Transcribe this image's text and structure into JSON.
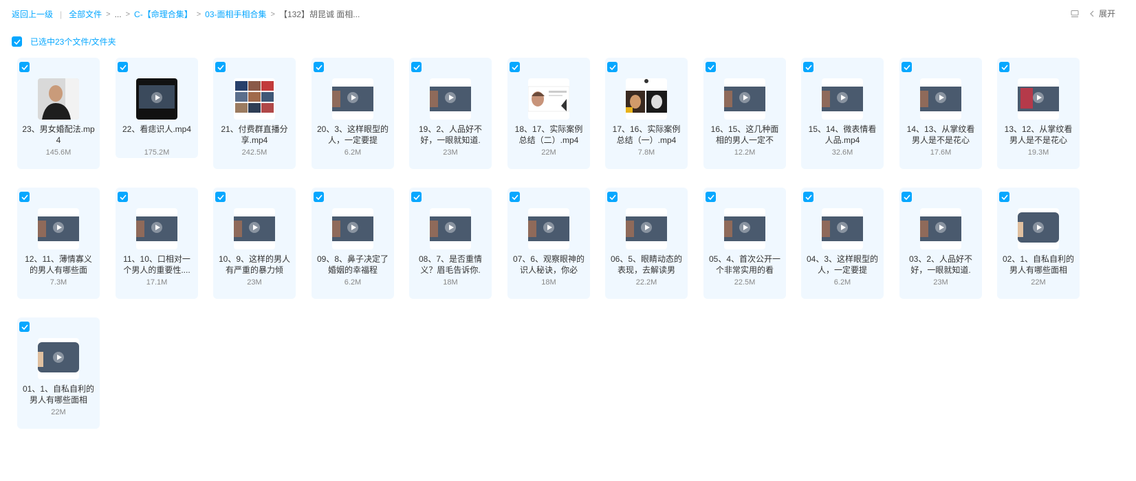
{
  "breadcrumb": {
    "back": "返回上一级",
    "all_files": "全部文件",
    "ellipsis": "...",
    "level1": "C-【命理合集】",
    "level2": "03-面相手相合集",
    "current": "【132】胡昆诚 面相..."
  },
  "top_right": {
    "expand_label": "展开",
    "icons": [
      "list-view-icon",
      "chevron-left-icon"
    ]
  },
  "selection": {
    "label": "已选中23个文件/文件夹"
  },
  "colors": {
    "accent": "#06a7ff",
    "card_bg": "#f0f8ff"
  },
  "files": [
    {
      "name": "23、男女婚配法.mp4",
      "size": "145.6M",
      "thumb": "photo-man"
    },
    {
      "name": "22、看痣识人.mp4",
      "size": "175.2M",
      "thumb": "video-dark"
    },
    {
      "name": "21、付费群直播分享.mp4",
      "size": "242.5M",
      "thumb": "collage"
    },
    {
      "name": "20、3、这样眼型的人，一定要提",
      "size": "6.2M",
      "thumb": "slide"
    },
    {
      "name": "19、2、人品好不好，一眼就知道.",
      "size": "23M",
      "thumb": "slide"
    },
    {
      "name": "18、17、实际案例总结（二）.mp4",
      "size": "22M",
      "thumb": "faces"
    },
    {
      "name": "17、16、实际案例总结（一）.mp4",
      "size": "7.8M",
      "thumb": "faces2"
    },
    {
      "name": "16、15、这几种面相的男人一定不",
      "size": "12.2M",
      "thumb": "slide"
    },
    {
      "name": "15、14、微表情看人品.mp4",
      "size": "32.6M",
      "thumb": "slide"
    },
    {
      "name": "14、13、从掌纹看男人是不是花心",
      "size": "17.6M",
      "thumb": "slide"
    },
    {
      "name": "13、12、从掌纹看男人是不是花心",
      "size": "19.3M",
      "thumb": "slide-red"
    },
    {
      "name": "12、11、薄情寡义的男人有哪些面",
      "size": "7.3M",
      "thumb": "slide"
    },
    {
      "name": "11、10、口相对一个男人的重要性....",
      "size": "17.1M",
      "thumb": "slide"
    },
    {
      "name": "10、9、这样的男人有严重的暴力倾",
      "size": "23M",
      "thumb": "slide"
    },
    {
      "name": "09、8、鼻子决定了婚姻的幸福程",
      "size": "6.2M",
      "thumb": "slide"
    },
    {
      "name": "08、7、是否重情义？眉毛告诉你.",
      "size": "18M",
      "thumb": "slide"
    },
    {
      "name": "07、6、观察眼神的识人秘诀，你必",
      "size": "18M",
      "thumb": "slide"
    },
    {
      "name": "06、5、眼睛动态的表现，去解读男",
      "size": "22.2M",
      "thumb": "slide"
    },
    {
      "name": "05、4、首次公开一个非常实用的看",
      "size": "22.5M",
      "thumb": "slide"
    },
    {
      "name": "04、3、这样眼型的人，一定要提",
      "size": "6.2M",
      "thumb": "slide"
    },
    {
      "name": "03、2、人品好不好，一眼就知道.",
      "size": "23M",
      "thumb": "slide"
    },
    {
      "name": "02、1、自私自利的男人有哪些面相",
      "size": "22M",
      "thumb": "slide-round"
    },
    {
      "name": "01、1、自私自利的男人有哪些面相",
      "size": "22M",
      "thumb": "slide-round"
    }
  ]
}
